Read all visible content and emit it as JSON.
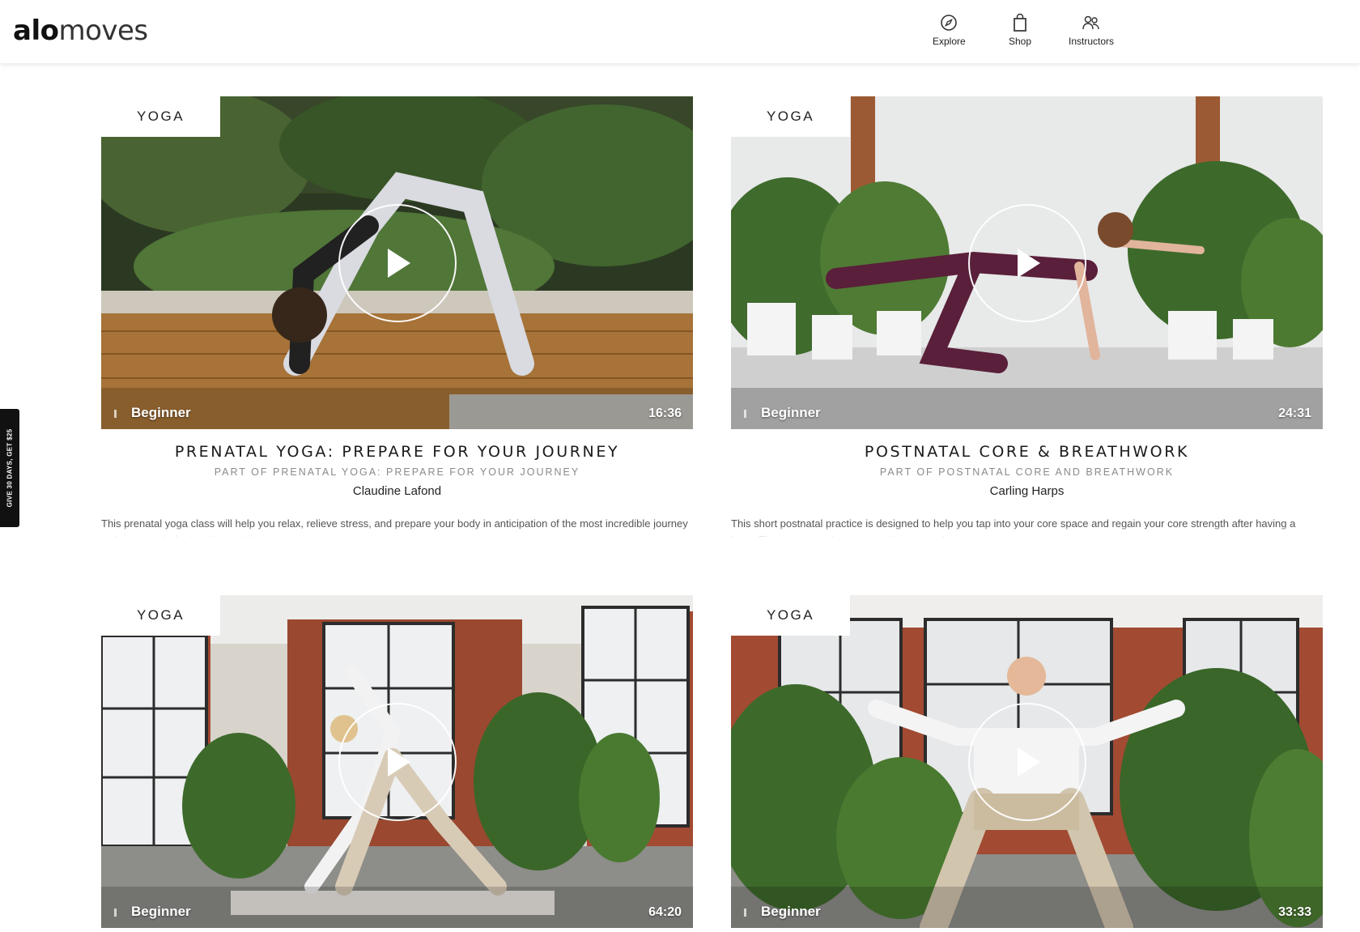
{
  "header": {
    "logo_bold": "alo",
    "logo_light": "moves",
    "nav": [
      {
        "label": "Explore",
        "icon": "compass-icon"
      },
      {
        "label": "Shop",
        "icon": "shopping-bag-icon"
      },
      {
        "label": "Instructors",
        "icon": "people-icon"
      }
    ]
  },
  "side_tab": {
    "label": "GIVE 30 DAYS, GET $25"
  },
  "cards": [
    {
      "category": "YOGA",
      "level": "Beginner",
      "duration": "16:36",
      "title": "PRENATAL YOGA: PREPARE FOR YOUR JOURNEY",
      "part_of": "PART OF PRENATAL YOGA: PREPARE FOR YOUR JOURNEY",
      "instructor": "Claudine Lafond",
      "description": "This prenatal yoga class will help you relax, relieve stress, and prepare your body in anticipation of the most incredible journey — bringing a baby into the world."
    },
    {
      "category": "YOGA",
      "level": "Beginner",
      "duration": "24:31",
      "title": "POSTNATAL CORE & BREATHWORK",
      "part_of": "PART OF POSTNATAL CORE AND BREATHWORK",
      "instructor": "Carling Harps",
      "description": "This short postnatal practice is designed to help you tap into your core space and regain your core strength after having a baby. These postnatal core strengtheners and"
    },
    {
      "category": "YOGA",
      "level": "Beginner",
      "duration": "64:20"
    },
    {
      "category": "YOGA",
      "level": "Beginner",
      "duration": "33:33"
    }
  ]
}
